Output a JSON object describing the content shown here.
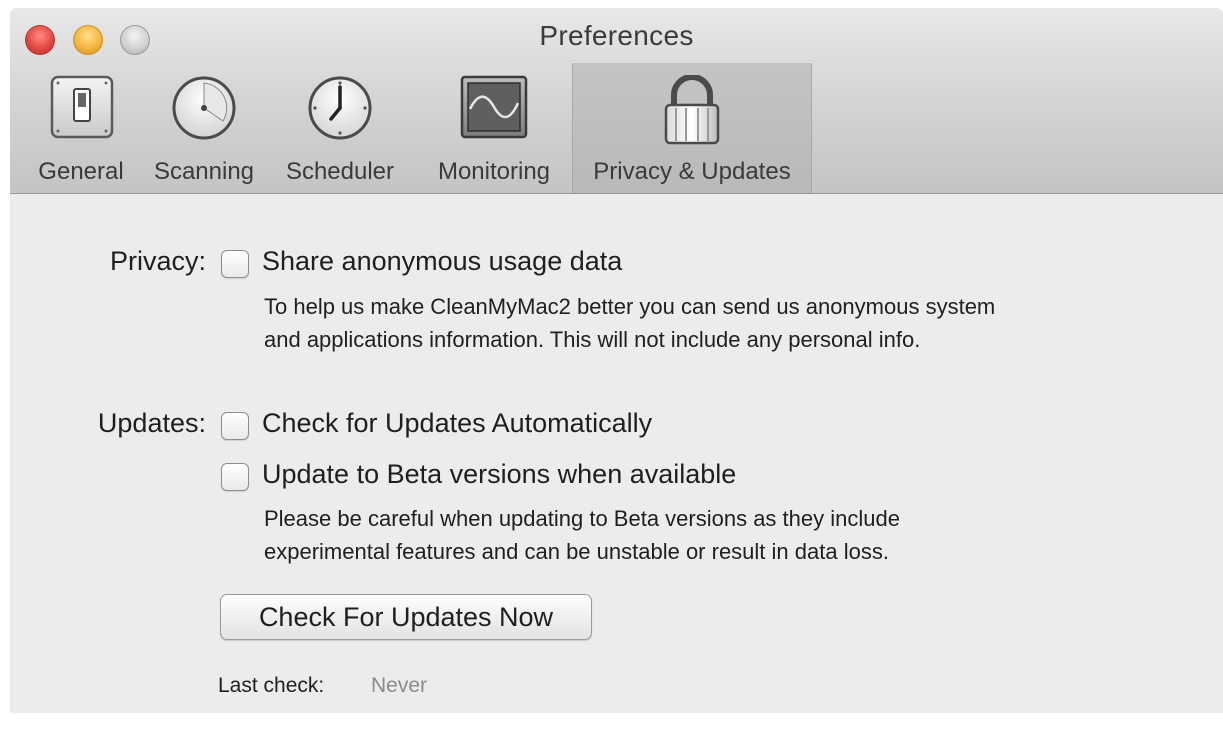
{
  "window": {
    "title": "Preferences"
  },
  "toolbar": {
    "items": [
      {
        "label": "General",
        "icon": "switch-icon"
      },
      {
        "label": "Scanning",
        "icon": "gauge-icon"
      },
      {
        "label": "Scheduler",
        "icon": "clock-icon"
      },
      {
        "label": "Monitoring",
        "icon": "monitor-icon"
      },
      {
        "label": "Privacy & Updates",
        "icon": "lock-icon",
        "selected": true
      }
    ]
  },
  "privacy": {
    "label": "Privacy:",
    "share_checkbox": {
      "label": "Share anonymous usage data",
      "checked": false
    },
    "description_lines": [
      "To help us make CleanMyMac2 better you can send us anonymous system",
      "and applications information. This will not include any personal info."
    ]
  },
  "updates": {
    "label": "Updates:",
    "auto_checkbox": {
      "label": "Check for Updates Automatically",
      "checked": false
    },
    "beta_checkbox": {
      "label": "Update to Beta versions when available",
      "checked": false
    },
    "description_lines": [
      "Please be careful when updating to Beta versions as they include",
      "experimental features and can be unstable or result in data loss."
    ],
    "check_now_button": "Check For Updates Now",
    "last_check_label": "Last check:",
    "last_check_value": "Never"
  },
  "colors": {
    "close": "#e0443e",
    "minimize": "#f3b13a",
    "zoom": "#cfcfcf",
    "window_bg": "#ececec",
    "muted_text": "#8a8a8a"
  }
}
